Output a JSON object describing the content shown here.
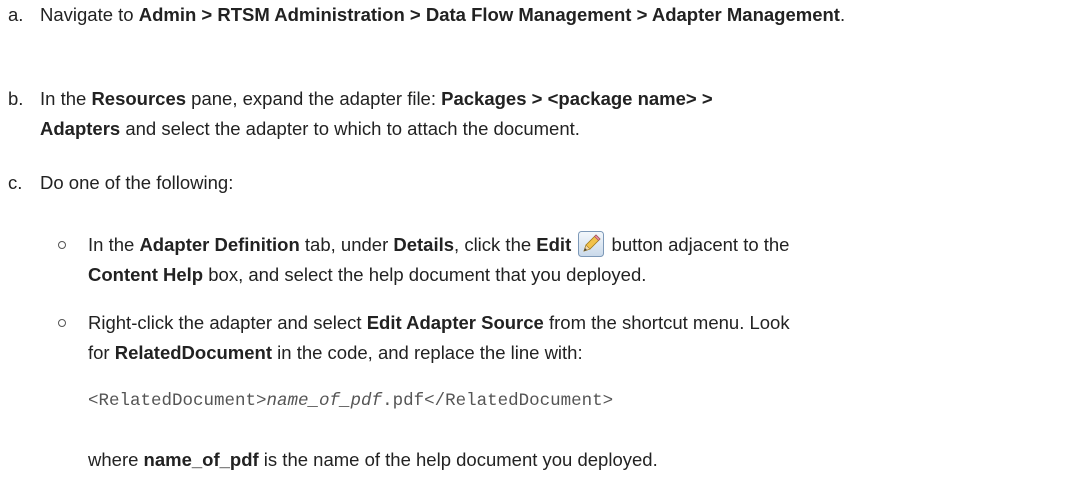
{
  "step_a": {
    "marker": "a.",
    "t1": "Navigate to ",
    "path": "Admin > RTSM Administration > Data Flow Management > Adapter Management",
    "t2": "."
  },
  "step_b": {
    "marker": "b.",
    "t1": "In the ",
    "resources": "Resources",
    "t2": " pane, expand the adapter file: ",
    "path_packages": "Packages > <package name> >",
    "path_adapters": "Adapters",
    "t3": " and select the adapter to which to attach the document."
  },
  "step_c": {
    "marker": "c.",
    "text": "Do one of the following:"
  },
  "bullet_1": {
    "t1": "In the ",
    "adapter_definition": "Adapter Definition",
    "t2": " tab, under ",
    "details": "Details",
    "t3": ", click the ",
    "edit": "Edit",
    "t4": " button adjacent to the",
    "content_help": "Content Help",
    "t5": " box, and select the help document that you deployed."
  },
  "bullet_2": {
    "t1": "Right-click the adapter and select ",
    "edit_adapter_source": "Edit Adapter Source",
    "t2": " from the shortcut menu. Look",
    "t3": "for ",
    "related_document": "RelatedDocument",
    "t4": " in the code, and replace the line with:"
  },
  "code_line": {
    "open_tag": "<RelatedDocument>",
    "name": "name_of_pdf",
    "ext": ".pdf",
    "close_tag": "</RelatedDocument>"
  },
  "where_line": {
    "t1": "where ",
    "name": "name_of_pdf",
    "t2": " is the name of the help document you deployed."
  },
  "icons": {
    "edit_icon": "pencil-edit-icon"
  }
}
